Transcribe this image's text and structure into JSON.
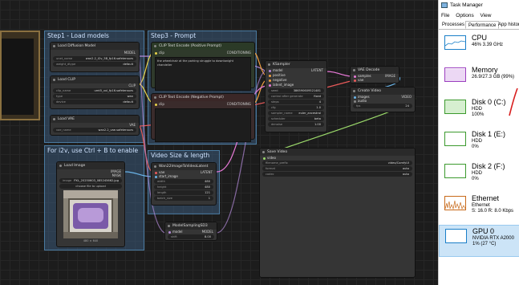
{
  "groups": [
    {
      "title": "Step1 - Load models",
      "color": "#3a5a7a"
    },
    {
      "title": "Step3 - Prompt",
      "color": "#3a5a7a"
    },
    {
      "title": "For i2v, use Ctrl + B to enable",
      "color": "#3a5a7a"
    },
    {
      "title": "Video Size & length",
      "color": "#3a5a7a"
    }
  ],
  "nodes": {
    "load_diffusion": {
      "title": "Load Diffusion Model",
      "output": "MODEL",
      "w1_label": "unet_name",
      "w1_value": "wan2.2_t2v_5B_fp16.safetensors",
      "w2_label": "weight_dtype",
      "w2_value": "default"
    },
    "load_clip": {
      "title": "Load CLIP",
      "output": "CLIP",
      "w1_label": "clip_name",
      "w1_value": "umt5_xxl_fp16.safetensors",
      "w2_label": "type",
      "w2_value": "wan",
      "w3_label": "device",
      "w3_value": "default"
    },
    "load_vae": {
      "title": "Load VAE",
      "output": "VAE",
      "w1_label": "vae_name",
      "w1_value": "wan2.2_vae.safetensors"
    },
    "clip_pos": {
      "title": "CLIP Text Encode (Positive Prompt)",
      "input": "clip",
      "output": "CONDITIONING",
      "text": "the wheelchair at the parking struggle to downtonight chandelier"
    },
    "clip_neg": {
      "title": "CLIP Text Encode (Negative Prompt)",
      "input": "clip",
      "output": "CONDITIONING",
      "text": ""
    },
    "ksampler": {
      "title": "KSampler",
      "in1": "model",
      "in2": "positive",
      "in3": "negative",
      "in4": "latent_image",
      "output": "LATENT",
      "widgets": [
        {
          "label": "seed",
          "value": "386590609521481"
        },
        {
          "label": "control after generate",
          "value": "fixed"
        },
        {
          "label": "steps",
          "value": "4"
        },
        {
          "label": "cfg",
          "value": "1.0"
        },
        {
          "label": "sampler_name",
          "value": "euler_ancestral"
        },
        {
          "label": "scheduler",
          "value": "beta"
        },
        {
          "label": "denoise",
          "value": "1.00"
        }
      ]
    },
    "vae_decode": {
      "title": "VAE Decode",
      "in1": "samples",
      "in2": "vae",
      "output": "IMAGE"
    },
    "create_video": {
      "title": "Create Video",
      "in1": "images",
      "in2": "audio",
      "output": "VIDEO",
      "w1_label": "fps",
      "w1_value": "24"
    },
    "save_video": {
      "title": "Save Video",
      "input": "video",
      "w1_label": "filename_prefix",
      "w1_value": "video/ComfyUI",
      "w2_label": "format",
      "w2_value": "auto",
      "w3_label": "codec",
      "w3_value": "auto"
    },
    "wan_latent": {
      "title": "Wan22ImageToVideoLatent",
      "in1": "vae",
      "in2": "start_image",
      "output": "LATENT",
      "widgets": [
        {
          "label": "width",
          "value": "480"
        },
        {
          "label": "height",
          "value": "480"
        },
        {
          "label": "length",
          "value": "121"
        },
        {
          "label": "batch_size",
          "value": "1"
        }
      ]
    },
    "load_image": {
      "title": "Load Image",
      "out1": "IMAGE",
      "out2": "MASK",
      "w1_label": "image",
      "w1_value": "PXL_20250603_085245662.jpg",
      "upload_label": "choose file to upload",
      "caption": "480 × 640"
    },
    "model_sampling": {
      "title": "ModelSamplingSD3",
      "input": "model",
      "output": "MODEL",
      "w1_label": "shift",
      "w1_value": "8.00"
    }
  },
  "taskmanager": {
    "title": "Task Manager",
    "menu": [
      "File",
      "Options",
      "View"
    ],
    "tabs": [
      "Processes",
      "Performance",
      "App histor"
    ],
    "active_tab": "Performance",
    "items": [
      {
        "name": "CPU",
        "line1": "46%  3.39 GHz",
        "line2": "",
        "color": "#1a7fc8"
      },
      {
        "name": "Memory",
        "line1": "26.9/27.3 GB (99%)",
        "line2": "",
        "color": "#9b3fbf"
      },
      {
        "name": "Disk 0 (C:)",
        "line1": "HDD",
        "line2": "100%",
        "color": "#3c9a2e"
      },
      {
        "name": "Disk 1 (E:)",
        "line1": "HDD",
        "line2": "0%",
        "color": "#3c9a2e"
      },
      {
        "name": "Disk 2 (F:)",
        "line1": "HDD",
        "line2": "0%",
        "color": "#3c9a2e"
      },
      {
        "name": "Ethernet",
        "line1": "Ethernet",
        "line2": "S: 16.0  R: 8.0 Kbps",
        "color": "#c86a1a"
      },
      {
        "name": "GPU 0",
        "line1": "NVIDIA RTX A2000",
        "line2": "1% (27 °C)",
        "color": "#1a7fc8"
      }
    ],
    "selected_index": 6
  }
}
